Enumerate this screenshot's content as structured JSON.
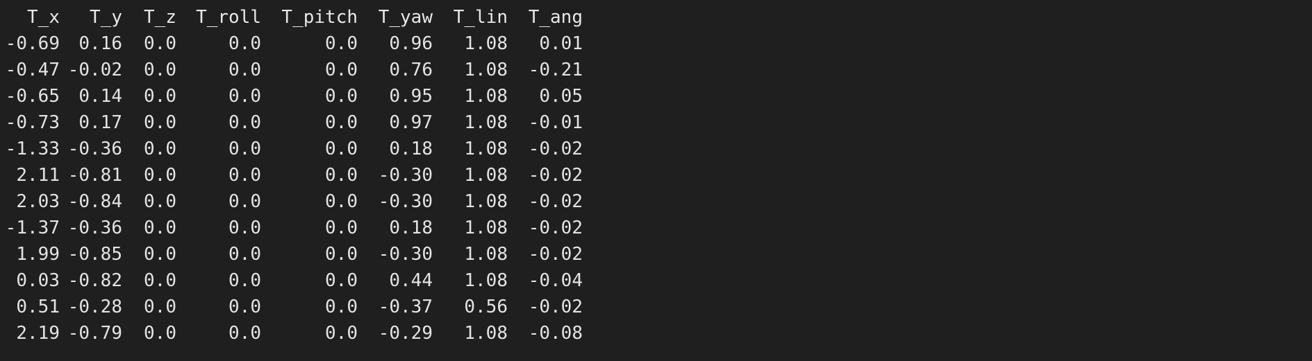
{
  "table": {
    "headers": [
      "T_x",
      "T_y",
      "T_z",
      "T_roll",
      "T_pitch",
      "T_yaw",
      "T_lin",
      "T_ang"
    ],
    "rows": [
      [
        "-0.69",
        "0.16",
        "0.0",
        "0.0",
        "0.0",
        "0.96",
        "1.08",
        "0.01"
      ],
      [
        "-0.47",
        "-0.02",
        "0.0",
        "0.0",
        "0.0",
        "0.76",
        "1.08",
        "-0.21"
      ],
      [
        "-0.65",
        "0.14",
        "0.0",
        "0.0",
        "0.0",
        "0.95",
        "1.08",
        "0.05"
      ],
      [
        "-0.73",
        "0.17",
        "0.0",
        "0.0",
        "0.0",
        "0.97",
        "1.08",
        "-0.01"
      ],
      [
        "-1.33",
        "-0.36",
        "0.0",
        "0.0",
        "0.0",
        "0.18",
        "1.08",
        "-0.02"
      ],
      [
        "2.11",
        "-0.81",
        "0.0",
        "0.0",
        "0.0",
        "-0.30",
        "1.08",
        "-0.02"
      ],
      [
        "2.03",
        "-0.84",
        "0.0",
        "0.0",
        "0.0",
        "-0.30",
        "1.08",
        "-0.02"
      ],
      [
        "-1.37",
        "-0.36",
        "0.0",
        "0.0",
        "0.0",
        "0.18",
        "1.08",
        "-0.02"
      ],
      [
        "1.99",
        "-0.85",
        "0.0",
        "0.0",
        "0.0",
        "-0.30",
        "1.08",
        "-0.02"
      ],
      [
        "0.03",
        "-0.82",
        "0.0",
        "0.0",
        "0.0",
        "0.44",
        "1.08",
        "-0.04"
      ],
      [
        "0.51",
        "-0.28",
        "0.0",
        "0.0",
        "0.0",
        "-0.37",
        "0.56",
        "-0.02"
      ],
      [
        "2.19",
        "-0.79",
        "0.0",
        "0.0",
        "0.0",
        "-0.29",
        "1.08",
        "-0.08"
      ]
    ]
  },
  "colors": {
    "background": "#1f1f1f",
    "text": "#e4e4e4"
  }
}
